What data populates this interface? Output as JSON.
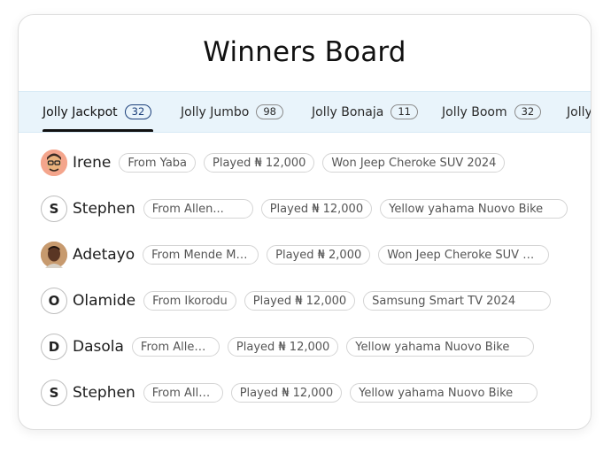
{
  "title": "Winners Board",
  "tabs": [
    {
      "label": "Jolly Jackpot",
      "count": "32"
    },
    {
      "label": "Jolly Jumbo",
      "count": "98"
    },
    {
      "label": "Jolly Bonaja",
      "count": "11"
    },
    {
      "label": "Jolly Boom",
      "count": "32"
    },
    {
      "label": "Jolly"
    }
  ],
  "winners": [
    {
      "name": "Irene",
      "avatar": "emoji-avatar",
      "from": "From Yaba",
      "played": "Played ₦ 12,000",
      "prize": "Won Jeep Cheroke SUV 2024"
    },
    {
      "name": "Stephen",
      "initial": "S",
      "from": "From Allen...",
      "played": "Played ₦ 12,000",
      "prize": "Yellow yahama Nuovo Bike"
    },
    {
      "name": "Adetayo",
      "avatar": "photo-avatar",
      "from": "From Mende Ma...",
      "played": "Played ₦ 2,000",
      "prize": "Won Jeep Cheroke SUV 2..."
    },
    {
      "name": "Olamide",
      "initial": "O",
      "from": "From Ikorodu",
      "played": "Played ₦ 12,000",
      "prize": "Samsung Smart TV 2024"
    },
    {
      "name": "Dasola",
      "initial": "D",
      "from": "From Allen...",
      "played": "Played ₦ 12,000",
      "prize": "Yellow yahama Nuovo Bike"
    },
    {
      "name": "Stephen",
      "initial": "S",
      "from": "From Allen...",
      "played": "Played ₦ 12,000",
      "prize": "Yellow yahama Nuovo Bike"
    }
  ]
}
